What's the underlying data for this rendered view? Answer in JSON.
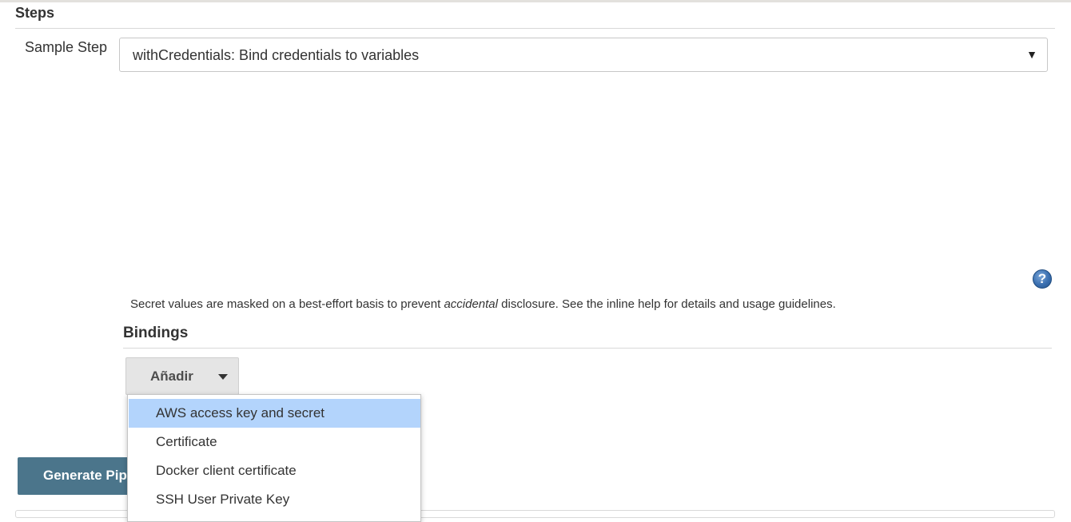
{
  "steps": {
    "title": "Steps"
  },
  "sample_step": {
    "label": "Sample Step",
    "selected_value": "withCredentials: Bind credentials to variables",
    "caret": "▼"
  },
  "help": {
    "icon": "question-circle-icon",
    "glyph": "?"
  },
  "note": {
    "before": "Secret values are masked on a best-effort basis to prevent ",
    "emphasis": "accidental",
    "after": " disclosure. See the inline help for details and usage guidelines."
  },
  "bindings": {
    "title": "Bindings",
    "add_button_label": "Añadir",
    "menu_items": [
      "AWS access key and secret",
      "Certificate",
      "Docker client certificate",
      "SSH User Private Key"
    ],
    "highlighted_index": 0
  },
  "generate_button_label": "Generate Pipeline Script",
  "colors": {
    "highlight": "#b3d4fc",
    "generate_bg": "#4b758b",
    "add_bg": "#e5e5e5"
  }
}
